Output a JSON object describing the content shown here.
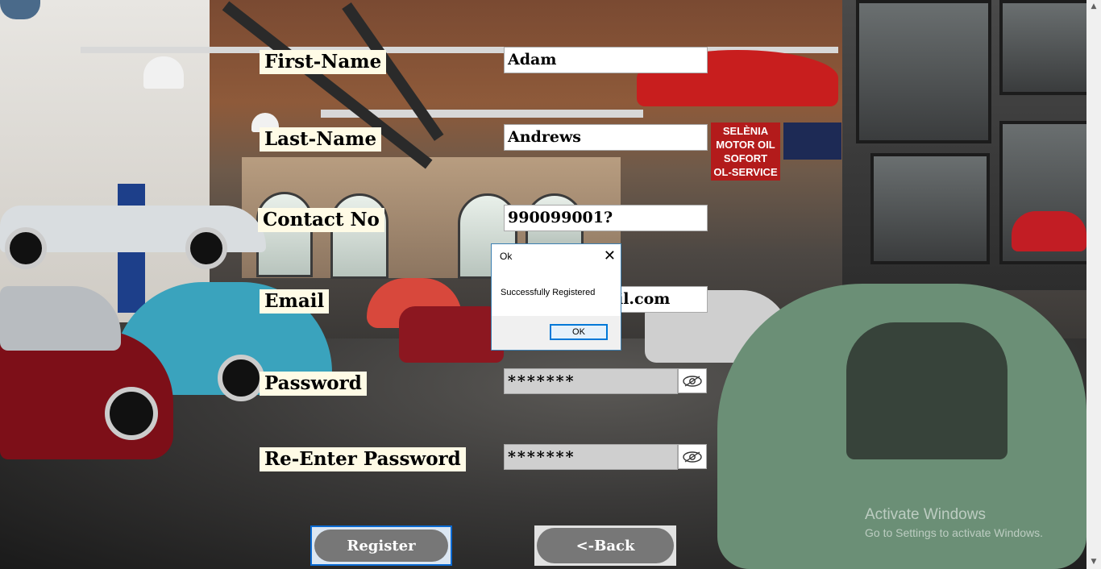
{
  "form": {
    "first_name_label": "First-Name",
    "last_name_label": "Last-Name",
    "contact_label": "Contact No",
    "email_label": "Email",
    "password_label": "Password",
    "reenter_label": "Re-Enter Password",
    "first_name_value": "Adam",
    "last_name_value": "Andrews",
    "contact_value": "990099001?",
    "email_value": "il.com",
    "password_value": "*******",
    "reenter_value": "*******",
    "register_label": "Register",
    "back_label": "<-Back"
  },
  "dialog": {
    "title": "Ok",
    "close_glyph": "✕",
    "message": "Successfully Registered",
    "ok_label": "OK"
  },
  "background": {
    "signs": [
      "SELÈNIA",
      "MOTOR OIL",
      "SOFORT",
      "OL-SERVICE"
    ]
  },
  "watermark": {
    "line1": "Activate Windows",
    "line2": "Go to Settings to activate Windows."
  },
  "scrollbar": {
    "up_glyph": "▲",
    "down_glyph": "▼"
  },
  "colors": {
    "label_bg": "#fffbe6",
    "button_fill": "#777777",
    "focus_border": "#0a6ad2",
    "password_bg": "#cfcfcf"
  },
  "icons": {
    "password_toggle": "eye-icon",
    "reenter_toggle": "eye-icon"
  }
}
